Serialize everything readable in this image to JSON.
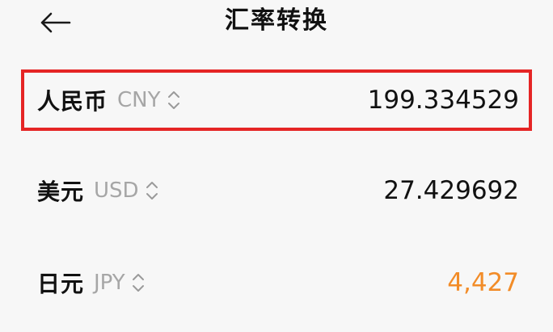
{
  "header": {
    "title": "汇率转换",
    "back_icon": "arrow-left-icon"
  },
  "currencies": [
    {
      "name": "人民币",
      "code": "CNY",
      "value": "199.334529",
      "selected": true,
      "value_color": "#111111"
    },
    {
      "name": "美元",
      "code": "USD",
      "value": "27.429692",
      "selected": false,
      "value_color": "#111111"
    },
    {
      "name": "日元",
      "code": "JPY",
      "value": "4,427",
      "selected": false,
      "value_color": "#f28c28"
    }
  ],
  "colors": {
    "background": "#f7f7f7",
    "selection_border": "#e52525",
    "code_gray": "#a6a6a6",
    "accent_orange": "#f28c28"
  }
}
